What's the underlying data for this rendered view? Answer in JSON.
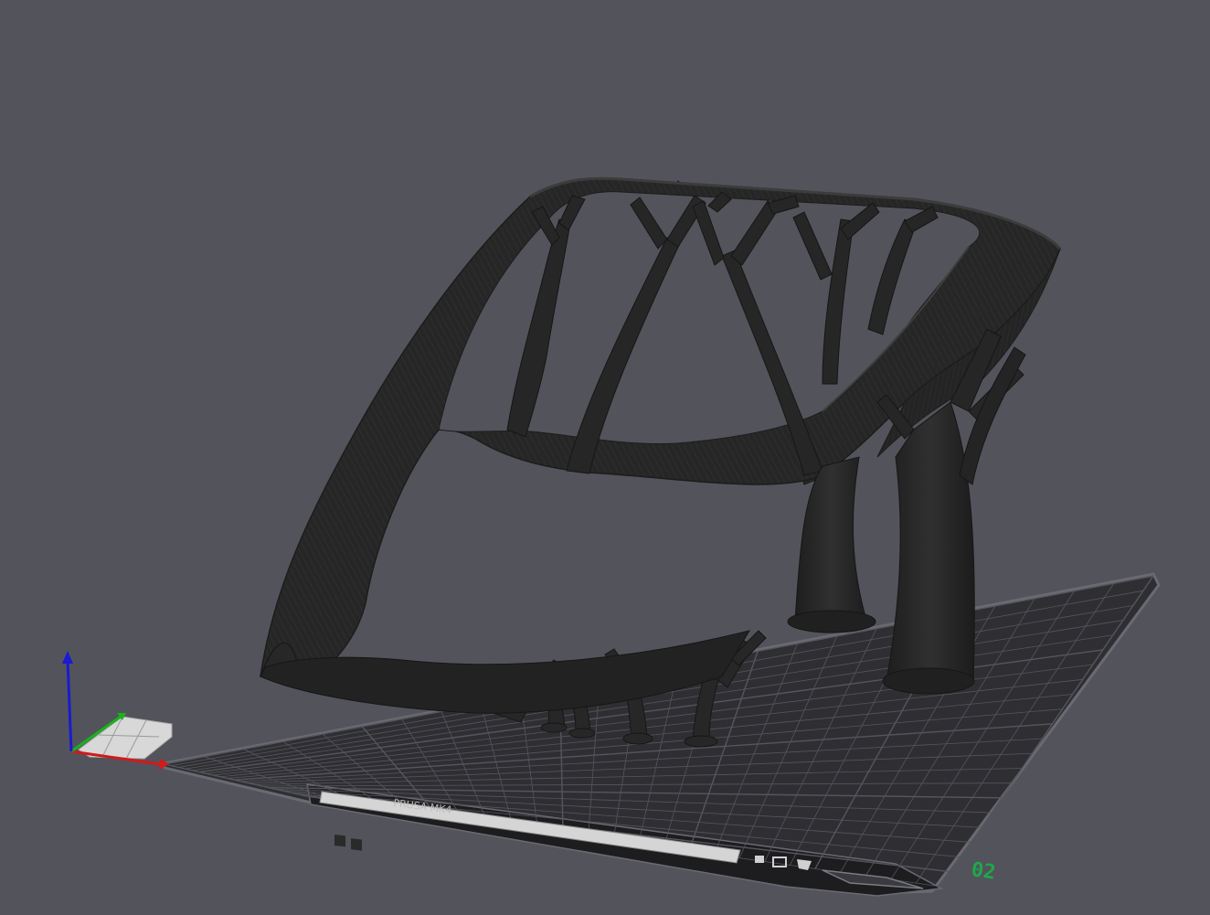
{
  "viewport": {
    "background_color": "#53535b"
  },
  "bed": {
    "surface_color": "#2f2f33",
    "grid_color": "#55555d",
    "edge_color": "#6a6a72",
    "plate_label": "02",
    "plate_label_color": "#1ea84a",
    "front_label_text": "PRUSA MK4",
    "front_label_color": "#d9d9d9"
  },
  "model": {
    "name": "print-model",
    "color": "#262626",
    "highlight_color": "#3a3a3a"
  },
  "axes": {
    "x_color": "#d11a1a",
    "y_color": "#17b31a",
    "z_color": "#1a1ad1"
  },
  "icons": {
    "navigation_cube": "view-cube-icon"
  }
}
